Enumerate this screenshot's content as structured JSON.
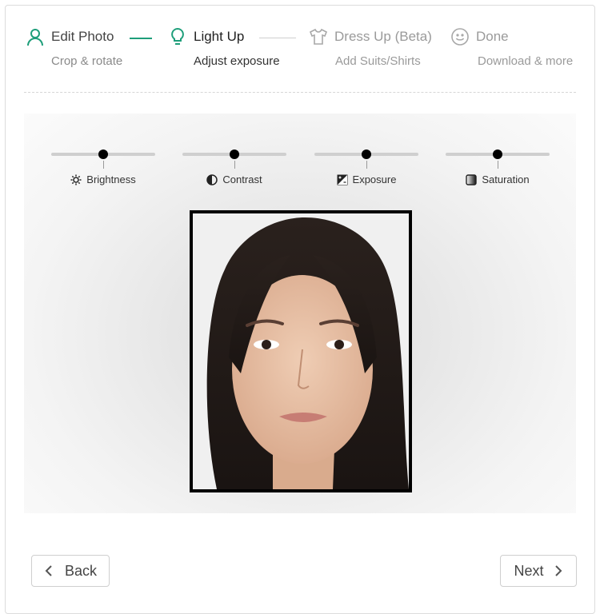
{
  "steps": [
    {
      "title": "Edit Photo",
      "subtitle": "Crop & rotate",
      "icon": "person-icon",
      "state": "completed"
    },
    {
      "title": "Light Up",
      "subtitle": "Adjust exposure",
      "icon": "lightbulb-icon",
      "state": "active"
    },
    {
      "title": "Dress Up (Beta)",
      "subtitle": "Add Suits/Shirts",
      "icon": "shirt-icon",
      "state": "upcoming"
    },
    {
      "title": "Done",
      "subtitle": "Download & more",
      "icon": "smiley-icon",
      "state": "upcoming"
    }
  ],
  "colors": {
    "accent": "#1e9e7a",
    "inactive": "#9a9a9a"
  },
  "sliders": [
    {
      "label": "Brightness",
      "icon": "sun-icon",
      "value": 0.5
    },
    {
      "label": "Contrast",
      "icon": "contrast-icon",
      "value": 0.5
    },
    {
      "label": "Exposure",
      "icon": "exposure-icon",
      "value": 0.5
    },
    {
      "label": "Saturation",
      "icon": "saturation-icon",
      "value": 0.5
    }
  ],
  "buttons": {
    "back": "Back",
    "next": "Next"
  }
}
